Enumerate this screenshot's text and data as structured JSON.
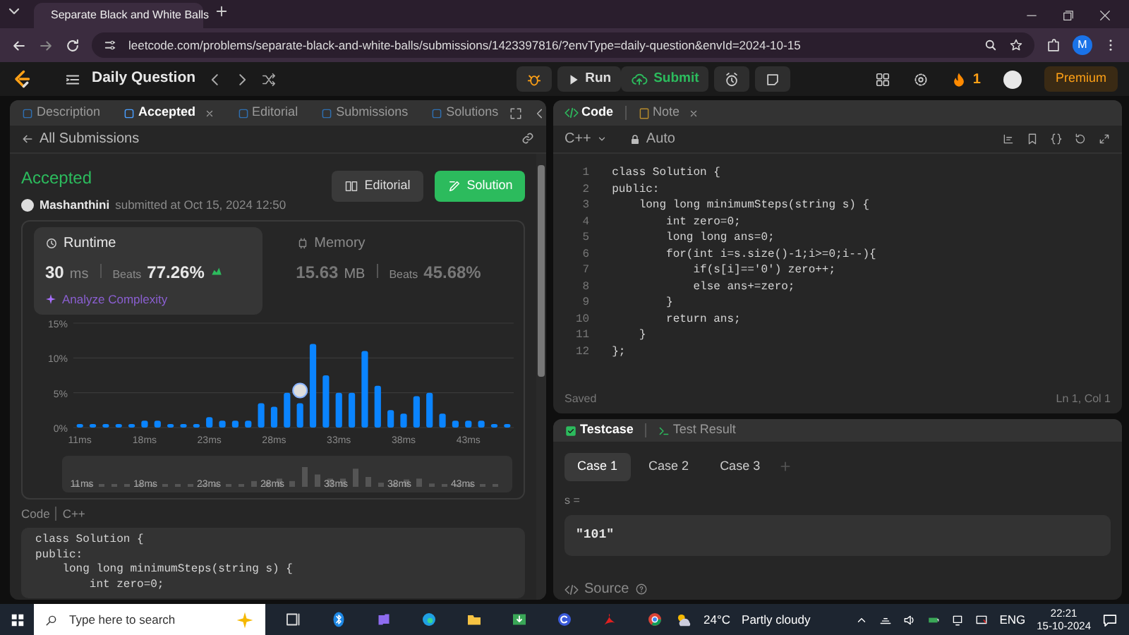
{
  "browser": {
    "tab_title": "Separate Black and White Balls",
    "url": "leetcode.com/problems/separate-black-and-white-balls/submissions/1423397816/?envType=daily-question&envId=2024-10-15",
    "profile_initial": "M"
  },
  "navbar": {
    "title": "Daily Question",
    "run": "Run",
    "submit": "Submit",
    "streak": "1",
    "premium": "Premium"
  },
  "left_tabs": [
    {
      "label": "Description",
      "selected": false,
      "closable": false
    },
    {
      "label": "Accepted",
      "selected": true,
      "closable": true
    },
    {
      "label": "Editorial",
      "selected": false,
      "closable": false
    },
    {
      "label": "Submissions",
      "selected": false,
      "closable": false
    },
    {
      "label": "Solutions",
      "selected": false,
      "closable": false
    }
  ],
  "back_link": "All Submissions",
  "result": {
    "status": "Accepted",
    "user": "Mashanthini",
    "submitted": "submitted at Oct 15, 2024 12:50",
    "editorial_button": "Editorial",
    "solution_button": "Solution"
  },
  "stats": [
    {
      "kind": "runtime",
      "title": "Runtime",
      "value": "30",
      "unit": "ms",
      "beats_label": "Beats",
      "beats": "77.26%",
      "selected": true,
      "analyze": "Analyze Complexity"
    },
    {
      "kind": "memory",
      "title": "Memory",
      "value": "15.63",
      "unit": "MB",
      "beats_label": "Beats",
      "beats": "45.68%",
      "selected": false
    }
  ],
  "chart_data": {
    "type": "bar",
    "categories": [
      "11ms",
      null,
      null,
      null,
      null,
      "18ms",
      null,
      null,
      null,
      null,
      "23ms",
      null,
      null,
      null,
      null,
      "28ms",
      null,
      null,
      null,
      null,
      "33ms",
      null,
      null,
      null,
      null,
      "38ms",
      null,
      null,
      null,
      null,
      "43ms",
      null,
      null,
      null
    ],
    "values": [
      0.5,
      0.5,
      0.5,
      0.5,
      0.5,
      1,
      1,
      0.5,
      0.5,
      0.5,
      1.5,
      1,
      1,
      1,
      3.5,
      3,
      5,
      3.5,
      12,
      7.5,
      5,
      5,
      11,
      6,
      2.5,
      2,
      4.5,
      5,
      2,
      1,
      1,
      1,
      0.5,
      0.5
    ],
    "ylim": [
      0,
      15
    ],
    "yticks": [
      {
        "value": 0,
        "label": "0%"
      },
      {
        "value": 5,
        "label": "5%"
      },
      {
        "value": 10,
        "label": "10%"
      },
      {
        "value": 15,
        "label": "15%"
      }
    ]
  },
  "overview_labels": [
    "11ms",
    "18ms",
    "23ms",
    "28ms",
    "33ms",
    "38ms",
    "43ms"
  ],
  "code_section": {
    "label": "Code",
    "language": "C++",
    "lines": [
      "class Solution {",
      "public:",
      "    long long minimumSteps(string s) {",
      "        int zero=0;"
    ]
  },
  "editor": {
    "tabs": [
      {
        "label": "Code",
        "selected": true,
        "closable": false
      },
      {
        "label": "Note",
        "selected": false,
        "closable": true
      }
    ],
    "language": "C++",
    "mode": "Auto",
    "lines": [
      {
        "n": "1",
        "code": "class Solution {"
      },
      {
        "n": "2",
        "code": "public:"
      },
      {
        "n": "3",
        "code": "    long long minimumSteps(string s) {"
      },
      {
        "n": "4",
        "code": "        int zero=0;"
      },
      {
        "n": "5",
        "code": "        long long ans=0;"
      },
      {
        "n": "6",
        "code": "        for(int i=s.size()-1;i>=0;i--){"
      },
      {
        "n": "7",
        "code": "            if(s[i]=='0') zero++;"
      },
      {
        "n": "8",
        "code": "            else ans+=zero;"
      },
      {
        "n": "9",
        "code": "        }"
      },
      {
        "n": "10",
        "code": "        return ans;"
      },
      {
        "n": "11",
        "code": "    }"
      },
      {
        "n": "12",
        "code": "};"
      }
    ],
    "status": "Saved",
    "cursor": "Ln 1, Col 1"
  },
  "testcase": {
    "tabs": [
      {
        "label": "Testcase",
        "selected": true
      },
      {
        "label": "Test Result",
        "selected": false
      }
    ],
    "cases": [
      {
        "label": "Case 1",
        "selected": true
      },
      {
        "label": "Case 2",
        "selected": false
      },
      {
        "label": "Case 3",
        "selected": false
      }
    ],
    "variable": "s =",
    "value": "\"101\"",
    "source": "Source"
  },
  "taskbar": {
    "search_placeholder": "Type here to search",
    "temperature": "24°C",
    "weather": "Partly cloudy",
    "language": "ENG",
    "time": "22:21",
    "date": "15-10-2024"
  }
}
